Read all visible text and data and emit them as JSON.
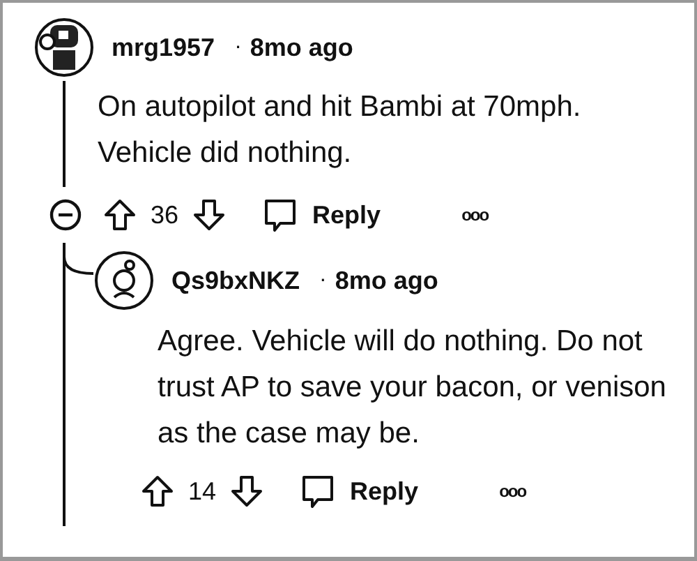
{
  "comments": [
    {
      "author": "mrg1957",
      "separator": "·",
      "time": "8mo ago",
      "body": "On autopilot and hit Bambi at 70mph. Vehicle did nothing.",
      "score": "36",
      "reply_label": "Reply",
      "more": "ooo",
      "expanded": true,
      "replies": [
        {
          "author": "Qs9bxNKZ",
          "separator": "·",
          "time": "8mo ago",
          "body": "Agree. Vehicle will do nothing. Do not trust AP to save your bacon, or venison as the case may be.",
          "score": "14",
          "reply_label": "Reply",
          "more": "ooo"
        }
      ]
    }
  ]
}
